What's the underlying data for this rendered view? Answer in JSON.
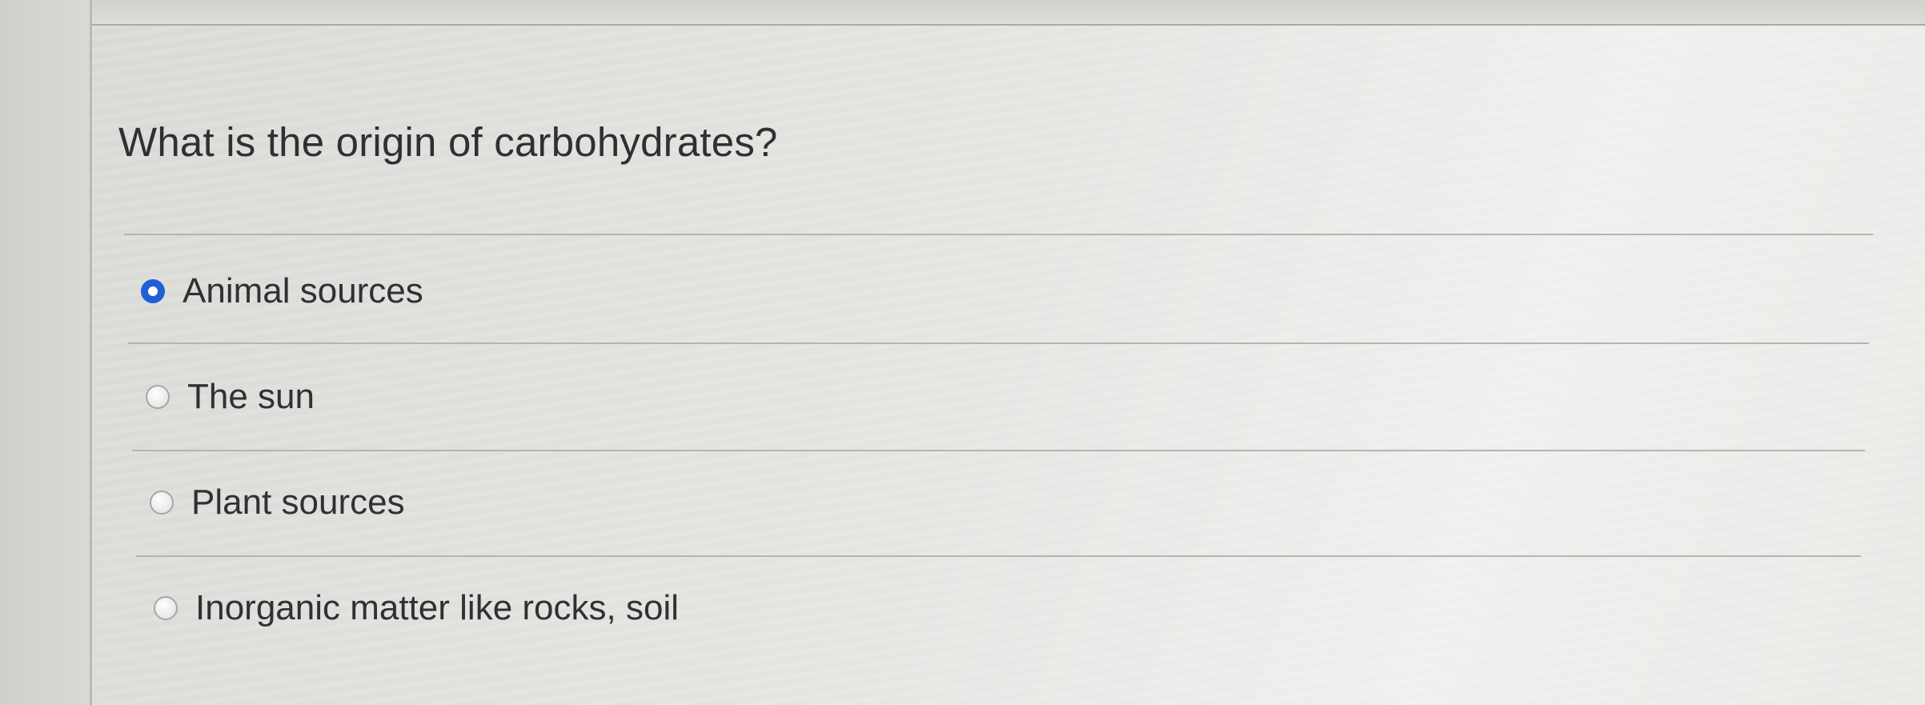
{
  "question": {
    "text": "What is the origin of carbohydrates?"
  },
  "options": [
    {
      "label": "Animal sources",
      "selected": true
    },
    {
      "label": "The sun",
      "selected": false
    },
    {
      "label": "Plant sources",
      "selected": false
    },
    {
      "label": "Inorganic matter like rocks, soil",
      "selected": false
    }
  ],
  "colors": {
    "selected_radio": "#1f5fd6",
    "text": "#2f3134"
  }
}
